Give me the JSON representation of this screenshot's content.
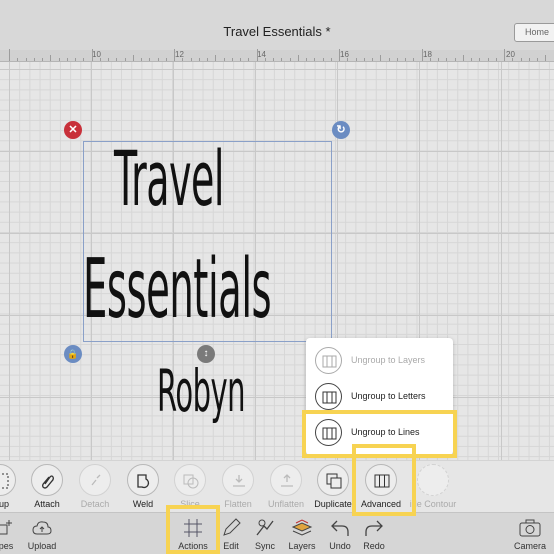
{
  "header": {
    "title": "Travel Essentials *",
    "home_label": "Home"
  },
  "ruler": {
    "labels": [
      "10",
      "12",
      "14",
      "16",
      "18",
      "20"
    ]
  },
  "canvas": {
    "lines": [
      "Travel",
      "Essentials",
      "Robyn"
    ]
  },
  "ungroup_menu": {
    "items": [
      {
        "label": "Ungroup to Layers",
        "enabled": false
      },
      {
        "label": "Ungroup to Letters",
        "enabled": true
      },
      {
        "label": "Ungroup to Lines",
        "enabled": true
      }
    ]
  },
  "action_bar": {
    "items": [
      {
        "label": "roup",
        "enabled": true
      },
      {
        "label": "Attach",
        "enabled": true
      },
      {
        "label": "Detach",
        "enabled": false
      },
      {
        "label": "Weld",
        "enabled": true
      },
      {
        "label": "Slice",
        "enabled": false
      },
      {
        "label": "Flatten",
        "enabled": false
      },
      {
        "label": "Unflatten",
        "enabled": false
      },
      {
        "label": "Duplicate",
        "enabled": true
      },
      {
        "label": "Advanced",
        "enabled": true
      },
      {
        "label": "ide Contour",
        "enabled": false
      }
    ]
  },
  "bottom_nav": {
    "items": [
      {
        "label": "pes",
        "icon": "shapes-icon"
      },
      {
        "label": "Upload",
        "icon": "upload-icon"
      },
      {
        "label": "Actions",
        "icon": "actions-icon"
      },
      {
        "label": "Edit",
        "icon": "edit-icon"
      },
      {
        "label": "Sync",
        "icon": "sync-icon"
      },
      {
        "label": "Layers",
        "icon": "layers-icon"
      },
      {
        "label": "Undo",
        "icon": "undo-icon"
      },
      {
        "label": "Redo",
        "icon": "redo-icon"
      },
      {
        "label": "Camera",
        "icon": "camera-icon"
      }
    ]
  },
  "colors": {
    "highlight": "#f7d352",
    "close_handle": "#c8303a",
    "handle_blue": "#6b8cc2"
  }
}
